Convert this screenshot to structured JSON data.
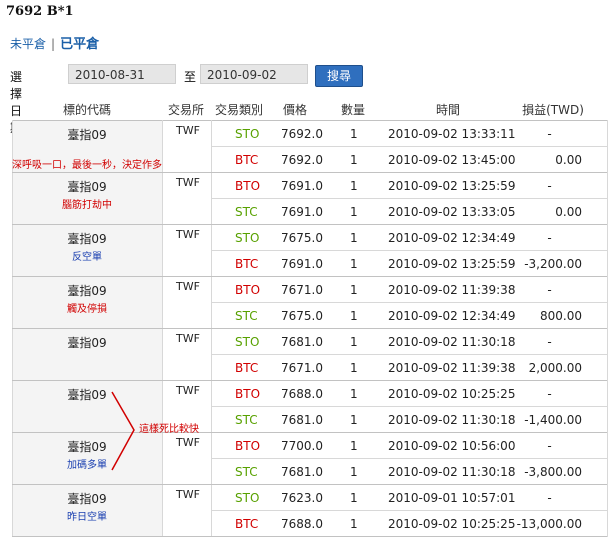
{
  "header": {
    "title": "7692 B*1"
  },
  "tabs": {
    "open_label": "未平倉",
    "separator": "|",
    "closed_label": "已平倉"
  },
  "filter": {
    "date_label": "選擇日期",
    "from_date": "2010-08-31",
    "to_label": "至",
    "to_date": "2010-09-02",
    "search_label": "搜尋"
  },
  "columns": [
    "標的代碼",
    "交易所",
    "交易類別",
    "價格",
    "數量",
    "時間",
    "損益(TWD)"
  ],
  "groups": [
    {
      "symbol": "臺指09",
      "exchange": "TWF",
      "note": "深呼吸一口，最後一秒，決定作多",
      "note_color": "red",
      "rows": [
        {
          "type": "STO",
          "type_color": "green",
          "price": "7692.0",
          "qty": "1",
          "time": "2010-09-02 13:33:11",
          "pnl": "-"
        },
        {
          "type": "BTC",
          "type_color": "red",
          "price": "7692.0",
          "qty": "1",
          "time": "2010-09-02 13:45:00",
          "pnl": "0.00"
        }
      ]
    },
    {
      "symbol": "臺指09",
      "exchange": "TWF",
      "note": "腦筋打劫中",
      "note_color": "red",
      "rows": [
        {
          "type": "BTO",
          "type_color": "red",
          "price": "7691.0",
          "qty": "1",
          "time": "2010-09-02 13:25:59",
          "pnl": "-"
        },
        {
          "type": "STC",
          "type_color": "green",
          "price": "7691.0",
          "qty": "1",
          "time": "2010-09-02 13:33:05",
          "pnl": "0.00"
        }
      ]
    },
    {
      "symbol": "臺指09",
      "exchange": "TWF",
      "note": "反空單",
      "note_color": "blue",
      "rows": [
        {
          "type": "STO",
          "type_color": "green",
          "price": "7675.0",
          "qty": "1",
          "time": "2010-09-02 12:34:49",
          "pnl": "-"
        },
        {
          "type": "BTC",
          "type_color": "red",
          "price": "7691.0",
          "qty": "1",
          "time": "2010-09-02 13:25:59",
          "pnl": "-3,200.00"
        }
      ]
    },
    {
      "symbol": "臺指09",
      "exchange": "TWF",
      "note": "觸及停損",
      "note_color": "red",
      "rows": [
        {
          "type": "BTO",
          "type_color": "red",
          "price": "7671.0",
          "qty": "1",
          "time": "2010-09-02 11:39:38",
          "pnl": "-"
        },
        {
          "type": "STC",
          "type_color": "green",
          "price": "7675.0",
          "qty": "1",
          "time": "2010-09-02 12:34:49",
          "pnl": "800.00"
        }
      ]
    },
    {
      "symbol": "臺指09",
      "exchange": "TWF",
      "note": "",
      "note_color": "red",
      "rows": [
        {
          "type": "STO",
          "type_color": "green",
          "price": "7681.0",
          "qty": "1",
          "time": "2010-09-02 11:30:18",
          "pnl": "-"
        },
        {
          "type": "BTC",
          "type_color": "red",
          "price": "7671.0",
          "qty": "1",
          "time": "2010-09-02 11:39:38",
          "pnl": "2,000.00"
        }
      ]
    },
    {
      "symbol": "臺指09",
      "exchange": "TWF",
      "note": "",
      "note_color": "red",
      "rows": [
        {
          "type": "BTO",
          "type_color": "red",
          "price": "7688.0",
          "qty": "1",
          "time": "2010-09-02 10:25:25",
          "pnl": "-"
        },
        {
          "type": "STC",
          "type_color": "green",
          "price": "7681.0",
          "qty": "1",
          "time": "2010-09-02 11:30:18",
          "pnl": "-1,400.00"
        }
      ]
    },
    {
      "symbol": "臺指09",
      "exchange": "TWF",
      "note": "加碼多單",
      "note_color": "blue",
      "rows": [
        {
          "type": "BTO",
          "type_color": "red",
          "price": "7700.0",
          "qty": "1",
          "time": "2010-09-02 10:56:00",
          "pnl": "-"
        },
        {
          "type": "STC",
          "type_color": "green",
          "price": "7681.0",
          "qty": "1",
          "time": "2010-09-02 11:30:18",
          "pnl": "-3,800.00"
        }
      ]
    },
    {
      "symbol": "臺指09",
      "exchange": "TWF",
      "note": "昨日空單",
      "note_color": "blue",
      "rows": [
        {
          "type": "STO",
          "type_color": "green",
          "price": "7623.0",
          "qty": "1",
          "time": "2010-09-01 10:57:01",
          "pnl": "-"
        },
        {
          "type": "BTC",
          "type_color": "red",
          "price": "7688.0",
          "qty": "1",
          "time": "2010-09-02 10:25:25",
          "pnl": "-13,000.00"
        }
      ]
    }
  ],
  "side_annotation": "這樣死比較快",
  "colors": {
    "red": "#d10000",
    "green": "#58a100",
    "blue": "#1a3fb0",
    "button": "#2f6fbe",
    "link": "#1a5fa8"
  }
}
